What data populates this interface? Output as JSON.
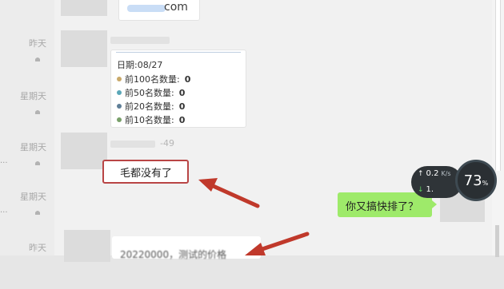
{
  "sidebar": {
    "items": [
      {
        "time": "昨天",
        "muted": true
      },
      {
        "time": "星期天",
        "muted": true
      },
      {
        "time": "星期天",
        "muted": true,
        "preview": "..."
      },
      {
        "time": "星期天",
        "muted": true,
        "preview": "..."
      },
      {
        "time": "昨天",
        "muted": false
      }
    ]
  },
  "chat": {
    "email_text": "com",
    "card": {
      "date": "日期:08/27",
      "rows": [
        {
          "label": "前100名数量:",
          "value": "0",
          "color": "#c9a96a"
        },
        {
          "label": "前50名数量:",
          "value": "0",
          "color": "#5aa7b8"
        },
        {
          "label": "前20名数量:",
          "value": "0",
          "color": "#5f7f97"
        },
        {
          "label": "前10名数量:",
          "value": "0",
          "color": "#79a06a"
        }
      ]
    },
    "sender_suffix": "-49",
    "reply_text": "毛都没有了",
    "blurred_text": "20220000，测试的价格",
    "outgoing_text": "你又搞快排了？"
  },
  "speed_widget": {
    "up_value": "0.2",
    "up_unit": "K/s",
    "down_value": "1.",
    "percent": "73",
    "percent_sign": "%"
  },
  "colors": {
    "annotation_red": "#c0392b",
    "outgoing_bubble": "#9eea6a"
  }
}
